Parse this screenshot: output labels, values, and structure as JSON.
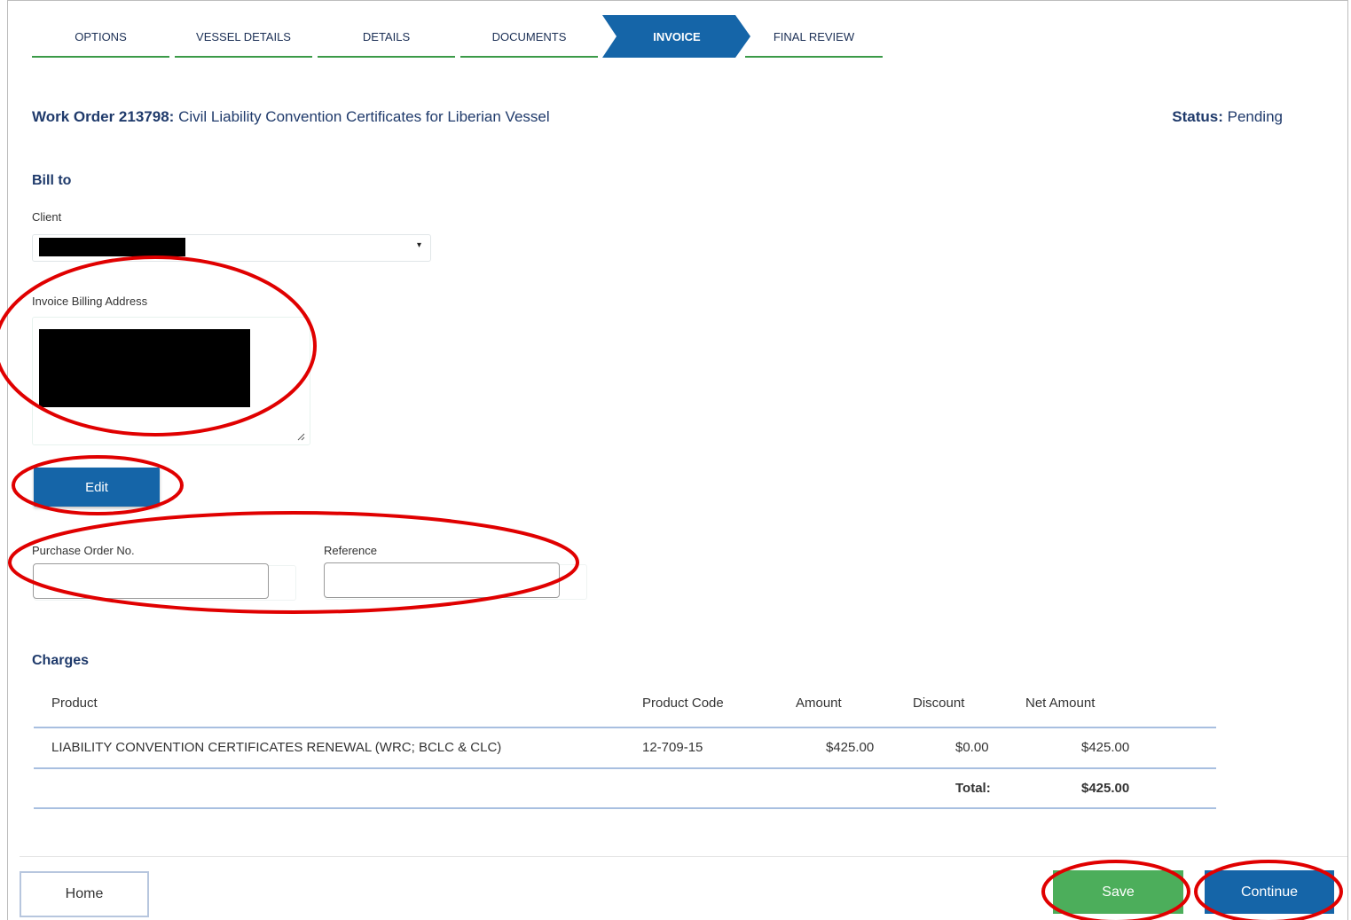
{
  "steps": [
    {
      "label": "OPTIONS",
      "active": false
    },
    {
      "label": "VESSEL DETAILS",
      "active": false
    },
    {
      "label": "DETAILS",
      "active": false
    },
    {
      "label": "DOCUMENTS",
      "active": false
    },
    {
      "label": "INVOICE",
      "active": true
    },
    {
      "label": "FINAL REVIEW",
      "active": false
    }
  ],
  "work_order": {
    "prefix": "Work Order 213798:",
    "title": "Civil Liability Convention Certificates for Liberian Vessel"
  },
  "status": {
    "label": "Status:",
    "value": "Pending"
  },
  "bill_to": {
    "heading": "Bill to",
    "client_label": "Client",
    "client_caret": "▾",
    "address_label": "Invoice Billing Address",
    "edit_label": "Edit",
    "po_label": "Purchase Order No.",
    "po_value": "",
    "reference_label": "Reference",
    "reference_value": ""
  },
  "charges": {
    "heading": "Charges",
    "columns": [
      "Product",
      "Product Code",
      "Amount",
      "Discount",
      "Net Amount"
    ],
    "rows": [
      {
        "product": "LIABILITY CONVENTION CERTIFICATES RENEWAL (WRC; BCLC & CLC)",
        "code": "12-709-15",
        "amount": "$425.00",
        "discount": "$0.00",
        "net": "$425.00"
      }
    ],
    "total_label": "Total:",
    "total_value": "$425.00"
  },
  "footer": {
    "home_label": "Home",
    "save_label": "Save",
    "continue_label": "Continue"
  },
  "colors": {
    "primary": "#1565a8",
    "success": "#4cae5b",
    "step_underline": "#3b9a48",
    "annotation": "#e00000",
    "text_navy": "#1f3a6b"
  }
}
